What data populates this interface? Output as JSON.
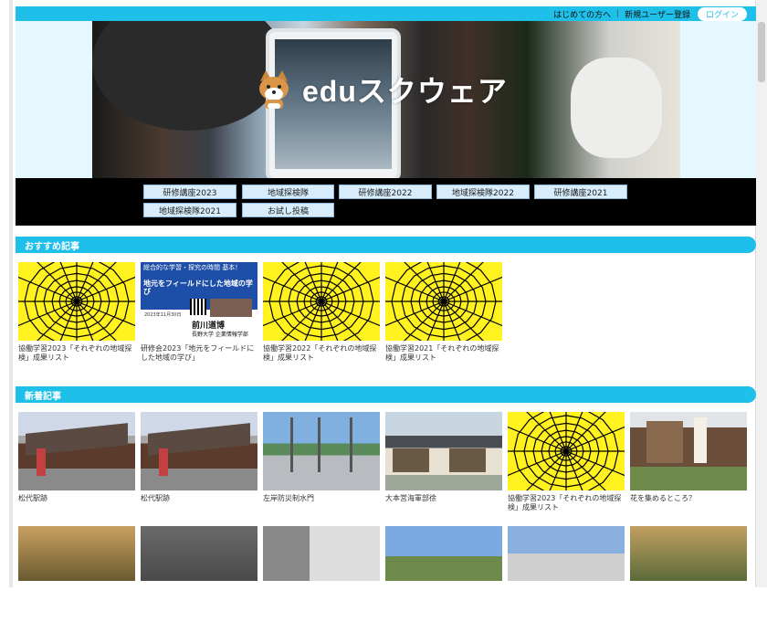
{
  "topbar": {
    "first_time": "はじめての方へ",
    "register": "新規ユーザー登録",
    "login": "ログイン"
  },
  "hero": {
    "logo_text": "eduスクウェア"
  },
  "nav": [
    "研修講座2023",
    "地域探検隊",
    "研修講座2022",
    "地域探検隊2022",
    "研修講座2021",
    "地域探検隊2021",
    "お試し投稿"
  ],
  "featured": {
    "heading": "おすすめ記事",
    "items": [
      {
        "caption": "協働学習2023「それぞれの地域探検」成果リスト",
        "thumb": "spiderweb"
      },
      {
        "caption": "研修会2023「地元をフィールドにした地域の学び」",
        "thumb": "lecture-slide",
        "slide": {
          "top_text": "総合的な学習・探究の時間 基本！",
          "title": "地元をフィールドにした地域の学び",
          "date": "2023年11月30日",
          "speaker": "前川道博",
          "affiliation": "長野大学 企業情報学部"
        }
      },
      {
        "caption": "協働学習2022「それぞれの地域探検」成果リスト",
        "thumb": "spiderweb"
      },
      {
        "caption": "協働学習2021「それぞれの地域探検」成果リスト",
        "thumb": "spiderweb"
      }
    ]
  },
  "latest": {
    "heading": "新着記事",
    "items": [
      {
        "caption": "松代駅跡",
        "thumb": "station"
      },
      {
        "caption": "松代駅跡",
        "thumb": "station"
      },
      {
        "caption": "左岸防災制水門",
        "thumb": "floodgate"
      },
      {
        "caption": "大本営海軍部徐",
        "thumb": "house"
      },
      {
        "caption": "協働学習2023「それぞれの地域探検」成果リスト",
        "thumb": "spiderweb"
      },
      {
        "caption": "花を集めるところ？",
        "thumb": "shrine"
      }
    ]
  },
  "colors": {
    "accent": "#1ec0ea",
    "web_bg": "#fff21e"
  }
}
